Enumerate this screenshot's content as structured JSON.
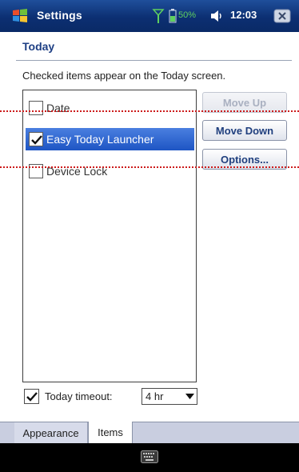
{
  "titlebar": {
    "title": "Settings",
    "battery": "50%",
    "time": "12:03"
  },
  "page": {
    "title": "Today",
    "instructions": "Checked items appear on the Today screen."
  },
  "items_list": [
    {
      "label": "Date",
      "checked": false,
      "selected": false
    },
    {
      "label": "Easy Today Launcher",
      "checked": true,
      "selected": true
    },
    {
      "label": "Device Lock",
      "checked": false,
      "selected": false
    }
  ],
  "buttons": {
    "move_up": "Move Up",
    "move_down": "Move Down",
    "options": "Options..."
  },
  "timeout": {
    "label": "Today timeout:",
    "checked": true,
    "value": "4 hr"
  },
  "tabs": [
    {
      "label": "Appearance",
      "active": false
    },
    {
      "label": "Items",
      "active": true
    }
  ],
  "colors": {
    "title_bar": "#0c2f72",
    "selection": "#1e55c4",
    "guide_line": "#cc1b1b",
    "button_text": "#1f3f7e"
  },
  "icons": {
    "start": "windows-flag-icon",
    "signal": "signal-icon",
    "battery": "battery-icon",
    "volume": "speaker-icon",
    "close": "close-icon",
    "keyboard": "keyboard-icon"
  }
}
